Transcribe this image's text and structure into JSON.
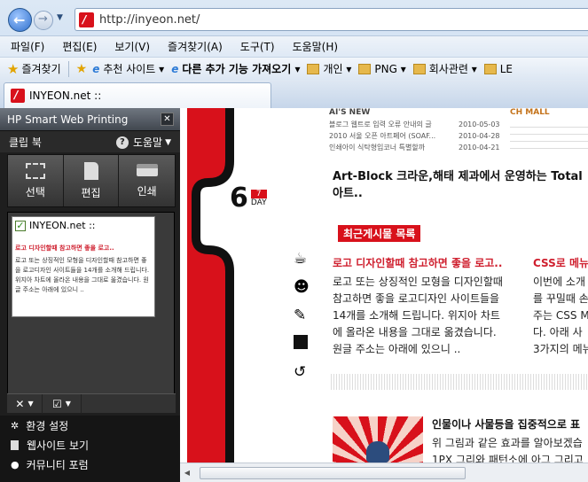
{
  "address": {
    "url": "http://inyeon.net/"
  },
  "menu": [
    "파일(F)",
    "편집(E)",
    "보기(V)",
    "즐겨찾기(A)",
    "도구(T)",
    "도움말(H)"
  ],
  "favorites": {
    "label": "즐겨찾기",
    "items": [
      "추천 사이트 ▾",
      "다른 추가 기능 가져오기 ▾",
      "개인 ▾",
      "PNG ▾",
      "회사관련 ▾",
      "LE"
    ]
  },
  "tab": {
    "title": "INYEON.net ::"
  },
  "panel": {
    "title": "HP Smart Web Printing",
    "clipbook": "클립 북",
    "help": "도움말",
    "tools": [
      {
        "label": "선택"
      },
      {
        "label": "편집"
      },
      {
        "label": "인쇄"
      }
    ],
    "clip": {
      "title": "INYEON.net ::",
      "headline": "로고 디자인할때 참고하면 좋을 로고..",
      "body": "로고 또는 상징적인 모형을 디자인할때 참고하면 좋을 로고디자인 사이트들을 14개를 소개해 드립니다. 위지아 차트에 올라온 내용을 그대로 옮겼습니다. 원글 주소는 아래에 있으니 .."
    },
    "links": [
      "환경 설정",
      "웹사이트 보기",
      "커뮤니티 포럼"
    ]
  },
  "page": {
    "news_header": "AI'S NEW",
    "news": [
      {
        "text": "블로그 웹트로 입력 오류 안내의 글",
        "date": "2010-05-03"
      },
      {
        "text": "2010 서울 오픈 아트페어 (SOAF...",
        "date": "2010-04-28"
      },
      {
        "text": "인쇄아이 식탁형입코너 특별할까",
        "date": "2010-04-21"
      }
    ],
    "mall_header": "CH MALL",
    "date_num": "6",
    "date_badge": "7",
    "date_day": "DAY",
    "headline": "Art-Block 크라운,해태 제과에서 운영하는 Total아트..",
    "recent_label": "최근게시물 목록",
    "post1_title": "로고 디자인할때 참고하면 좋을 로고..",
    "post1_lines": [
      "로고 또는 상징적인 모형을 디자인할때",
      "참고하면 좋을 로고디자인 사이트들을",
      "14개를 소개해 드립니다. 위지아 차트",
      "에 올라온 내용을 그대로 옮겼습니다.",
      "원글 주소는 아래에 있으니 .."
    ],
    "post2_title": "CSS로 메뉴",
    "post2_lines": [
      "이번에 소개",
      "를 꾸밀때 손",
      "주는 CSS M",
      "다. 아래 사",
      "3가지의 메뉴"
    ],
    "post3_title": "인물이나 사물등을 집중적으로 표",
    "post3_lines": [
      "위 그림과 같은 효과를 알아보겠습",
      "1PX 그리와 패턴소에 아그 그리고"
    ]
  },
  "colors": {
    "accent": "#d8111b",
    "panel_bg": "#1e1e1e"
  }
}
